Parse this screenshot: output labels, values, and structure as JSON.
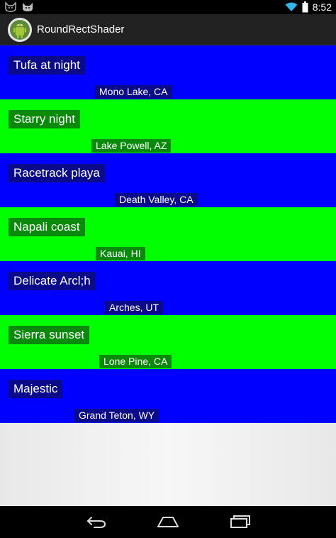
{
  "status_bar": {
    "time": "8:52",
    "left_icons": [
      "cat-icon",
      "cat-icon"
    ],
    "right_icons": [
      "wifi-icon",
      "battery-icon"
    ]
  },
  "app": {
    "title": "RoundRectShader",
    "icon": "android-app-icon"
  },
  "colors": {
    "blue_row": "#0000ff",
    "green_row": "#00ff00",
    "blue_label": "#0a0a8a",
    "green_label": "#0a8a0a"
  },
  "items": [
    {
      "title": "Tufa at night",
      "subtitle": "Mono Lake, CA",
      "theme": "blue"
    },
    {
      "title": "Starry night",
      "subtitle": "Lake Powell, AZ",
      "theme": "green"
    },
    {
      "title": "Racetrack playa",
      "subtitle": "Death Valley, CA",
      "theme": "blue"
    },
    {
      "title": "Napali coast",
      "subtitle": "Kauai, HI",
      "theme": "green"
    },
    {
      "title": "Delicate Arcl;h",
      "subtitle": "Arches, UT",
      "theme": "blue"
    },
    {
      "title": "Sierra sunset",
      "subtitle": "Lone Pine, CA",
      "theme": "green"
    },
    {
      "title": "Majestic",
      "subtitle": "Grand Teton, WY",
      "theme": "blue"
    }
  ],
  "nav_bar": {
    "buttons": [
      "back-icon",
      "home-icon",
      "recent-apps-icon"
    ]
  }
}
